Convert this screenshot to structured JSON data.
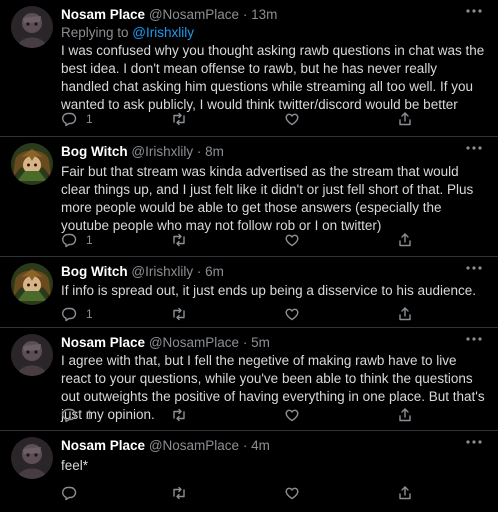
{
  "tweets": [
    {
      "name": "Nosam Place",
      "handle": "@NosamPlace",
      "dot": "·",
      "time": "13m",
      "replying_prefix": "Replying to ",
      "replying_handle": "@Irishxlily",
      "text": "I was confused why you thought asking rawb questions in chat was the best idea. I don't mean offense to rawb, but he has never really handled chat asking him questions while streaming all too well. If you wanted to ask publicly, I would think twitter/discord would be better",
      "reply_count": "1",
      "avatar": "nosam-avatar"
    },
    {
      "name": "Bog Witch",
      "handle": "@Irishxlily",
      "dot": "·",
      "time": "8m",
      "text": "Fair but that stream was kinda advertised as the stream that would clear things up, and I just felt like it didn't or just fell short of that. Plus more people would be able to get those answers (especially the youtube people who may not follow rob or I on twitter)",
      "reply_count": "1",
      "avatar": "bog-witch-avatar"
    },
    {
      "name": "Bog Witch",
      "handle": "@Irishxlily",
      "dot": "·",
      "time": "6m",
      "text": "If info is spread out, it just ends up being a disservice to his audience.",
      "reply_count": "1",
      "avatar": "bog-witch-avatar"
    },
    {
      "name": "Nosam Place",
      "handle": "@NosamPlace",
      "dot": "·",
      "time": "5m",
      "text": "I agree with that, but I fell the negetive of making rawb have to live react to your questions, while you've been able to think the questions out outweights the positive of having everything in one place. But that's just my opinion.",
      "reply_count": "1",
      "avatar": "nosam-avatar"
    },
    {
      "name": "Nosam Place",
      "handle": "@NosamPlace",
      "dot": "·",
      "time": "4m",
      "text": "feel*",
      "reply_count": "",
      "avatar": "nosam-avatar"
    }
  ],
  "icons": {
    "reply": "reply-icon",
    "retweet": "retweet-icon",
    "like": "heart-icon",
    "share": "share-icon",
    "more": "more-options-icon"
  },
  "colors": {
    "background": "#000000",
    "name": "#ffffff",
    "text": "#d9d9d9",
    "muted": "#8b8f94",
    "link": "#1d9bf0",
    "divider": "#2f3336"
  }
}
